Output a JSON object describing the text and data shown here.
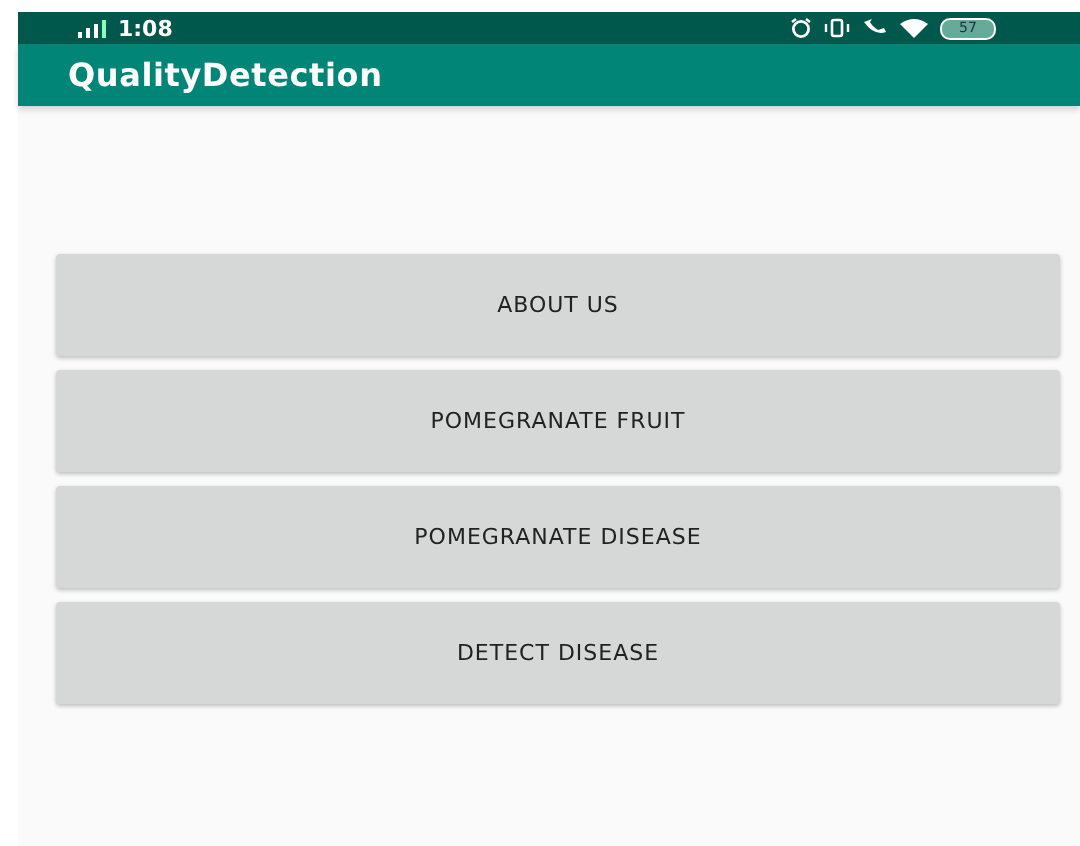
{
  "status_bar": {
    "time": "1:08",
    "battery": "57"
  },
  "app_bar": {
    "title": "QualityDetection"
  },
  "buttons": [
    {
      "label": "ABOUT US"
    },
    {
      "label": "POMEGRANATE FRUIT"
    },
    {
      "label": "POMEGRANATE DISEASE"
    },
    {
      "label": "DETECT DISEASE"
    }
  ]
}
